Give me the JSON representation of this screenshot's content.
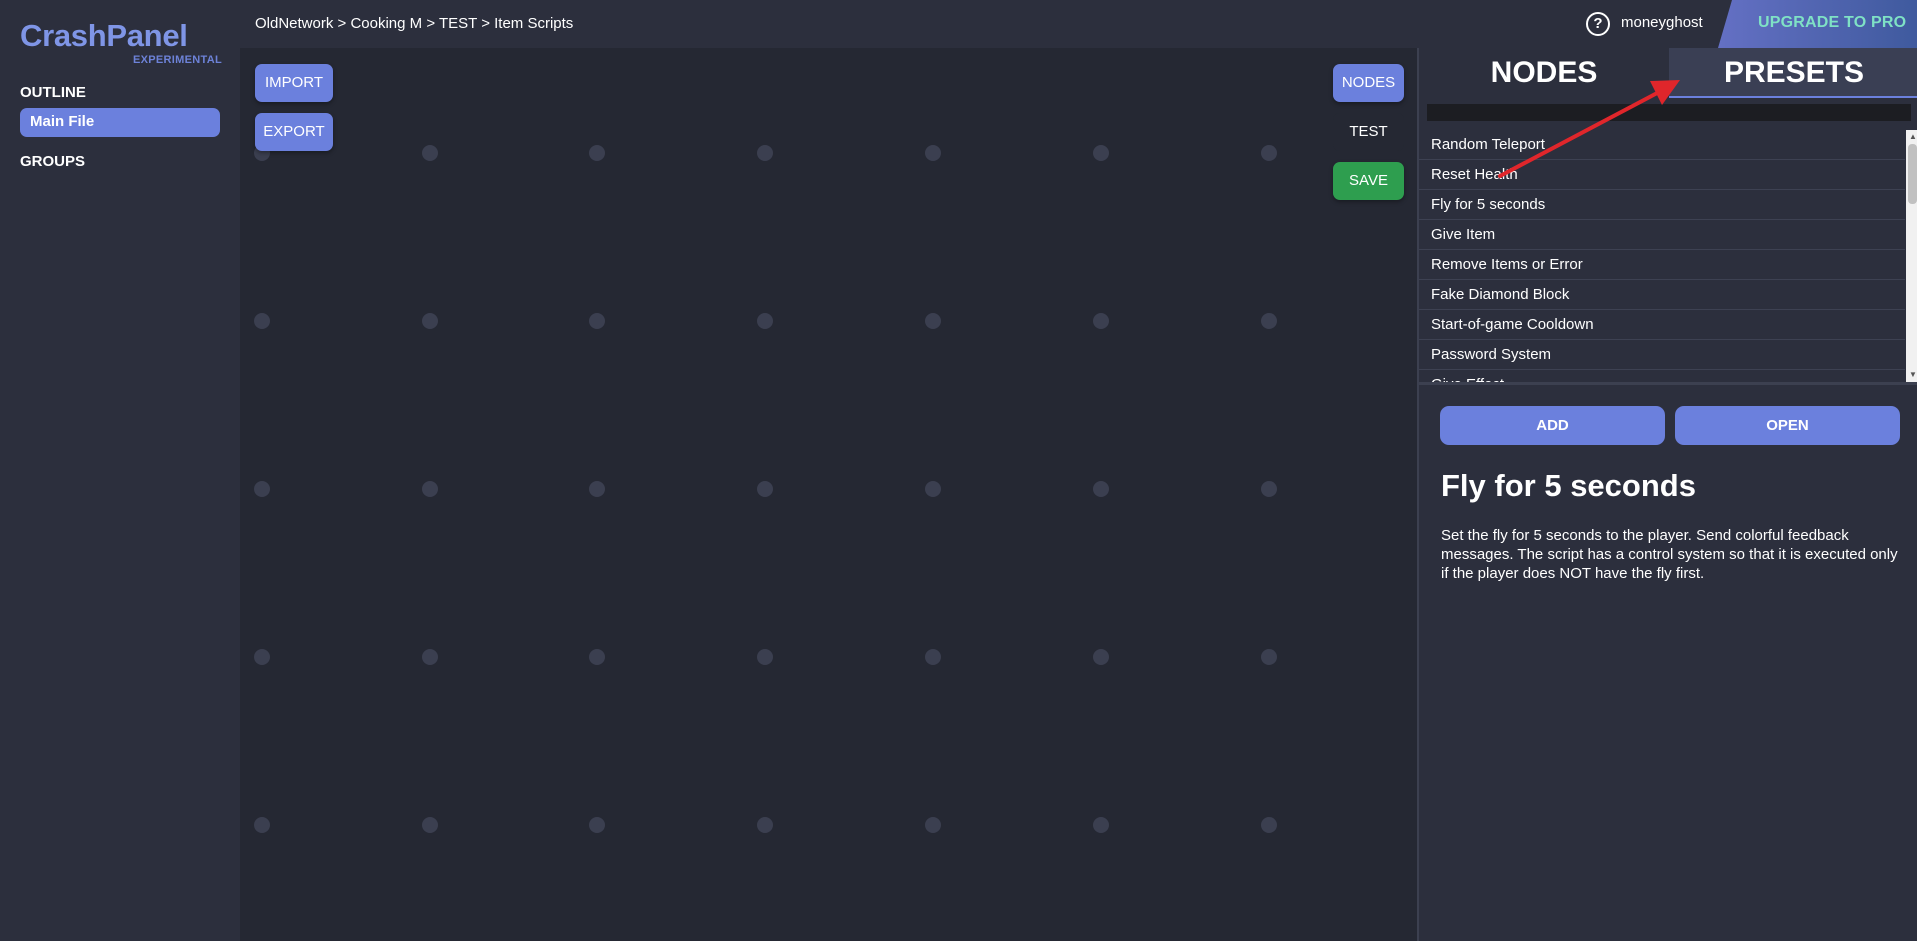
{
  "app": {
    "name": "CrashPanel",
    "tag": "EXPERIMENTAL"
  },
  "sidebar": {
    "outline_heading": "OUTLINE",
    "items": [
      {
        "label": "Main File"
      }
    ],
    "groups_heading": "GROUPS"
  },
  "header": {
    "breadcrumb": "OldNetwork > Cooking M > TEST > Item Scripts",
    "help_icon": "?",
    "username": "moneyghost",
    "upgrade_label": "UPGRADE TO PRO"
  },
  "canvas": {
    "import_label": "IMPORT",
    "export_label": "EXPORT",
    "nodes_label": "NODES",
    "test_label": "TEST",
    "save_label": "SAVE"
  },
  "panel": {
    "tabs": [
      {
        "label": "NODES",
        "active": false
      },
      {
        "label": "PRESETS",
        "active": true
      }
    ],
    "search_value": "",
    "presets": [
      {
        "label": "Random Teleport"
      },
      {
        "label": "Reset Health"
      },
      {
        "label": "Fly for 5 seconds"
      },
      {
        "label": "Give Item"
      },
      {
        "label": "Remove Items or Error"
      },
      {
        "label": "Fake Diamond Block"
      },
      {
        "label": "Start-of-game Cooldown"
      },
      {
        "label": "Password System"
      },
      {
        "label": "Give Effect"
      }
    ],
    "add_label": "ADD",
    "open_label": "OPEN",
    "selected": {
      "title": "Fly for 5 seconds",
      "description": "Set the fly for 5 seconds to the player. Send colorful feedback messages. The script has a control system so that it is executed only if the player does NOT have the fly first."
    }
  },
  "colors": {
    "accent": "#6b80dd",
    "save": "#2e9e4f",
    "upgrade_text": "#7fe1c5",
    "annotation_arrow": "#e0262b"
  }
}
